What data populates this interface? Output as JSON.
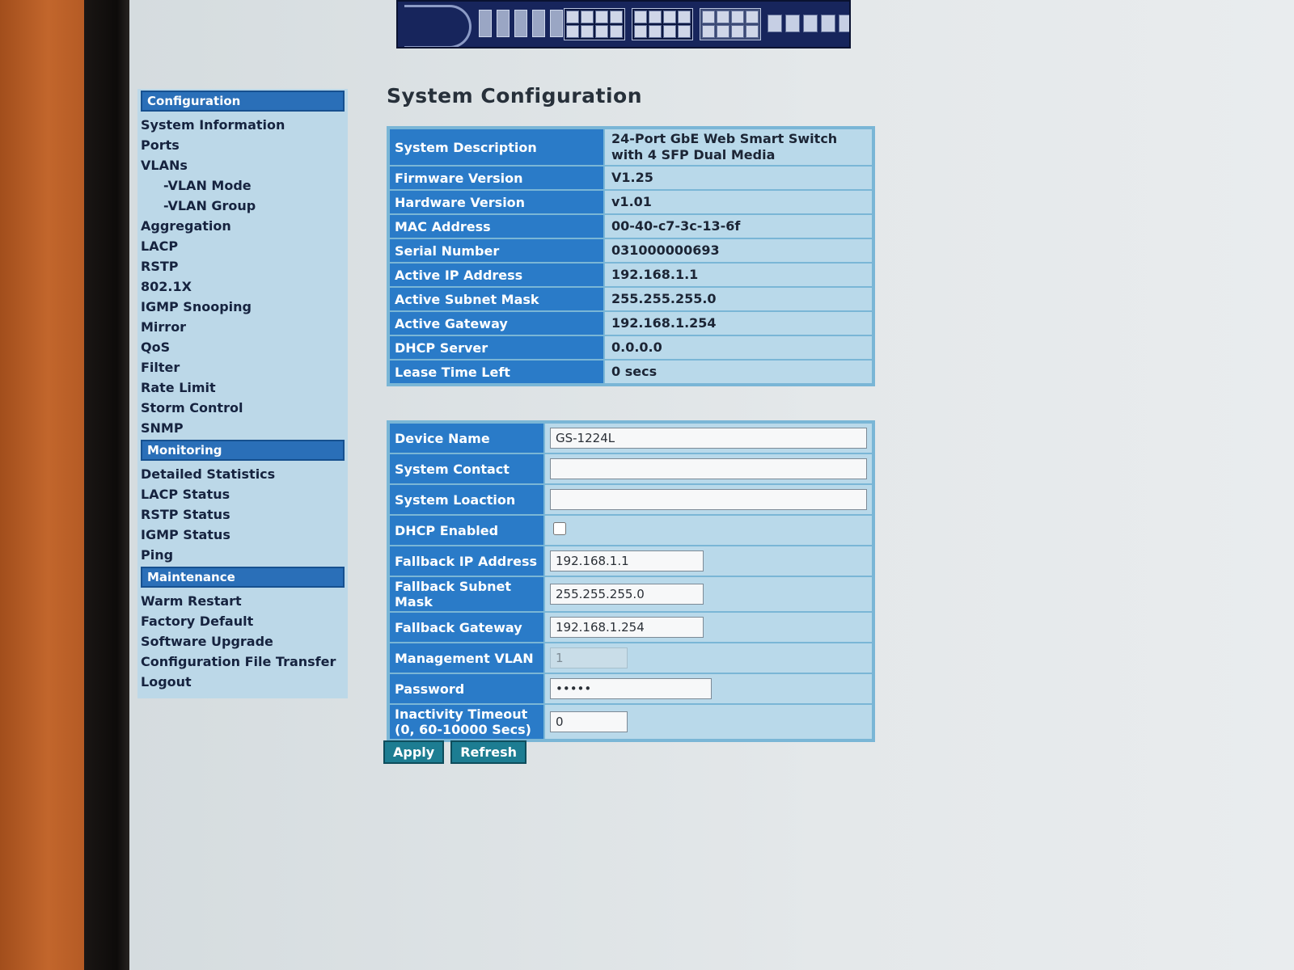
{
  "page": {
    "title": "System Configuration"
  },
  "nav": {
    "sections": [
      {
        "header": "Configuration",
        "items": [
          {
            "label": "System Information",
            "sub": false
          },
          {
            "label": "Ports",
            "sub": false
          },
          {
            "label": "VLANs",
            "sub": false
          },
          {
            "label": "-VLAN Mode",
            "sub": true
          },
          {
            "label": "-VLAN Group",
            "sub": true
          },
          {
            "label": "Aggregation",
            "sub": false
          },
          {
            "label": "LACP",
            "sub": false
          },
          {
            "label": "RSTP",
            "sub": false
          },
          {
            "label": "802.1X",
            "sub": false
          },
          {
            "label": "IGMP Snooping",
            "sub": false
          },
          {
            "label": "Mirror",
            "sub": false
          },
          {
            "label": "QoS",
            "sub": false
          },
          {
            "label": "Filter",
            "sub": false
          },
          {
            "label": "Rate Limit",
            "sub": false
          },
          {
            "label": "Storm Control",
            "sub": false
          },
          {
            "label": "SNMP",
            "sub": false
          }
        ]
      },
      {
        "header": "Monitoring",
        "items": [
          {
            "label": "Detailed Statistics",
            "sub": false
          },
          {
            "label": "LACP Status",
            "sub": false
          },
          {
            "label": "RSTP Status",
            "sub": false
          },
          {
            "label": "IGMP Status",
            "sub": false
          },
          {
            "label": "Ping",
            "sub": false
          }
        ]
      },
      {
        "header": "Maintenance",
        "items": [
          {
            "label": "Warm Restart",
            "sub": false
          },
          {
            "label": "Factory Default",
            "sub": false
          },
          {
            "label": "Software Upgrade",
            "sub": false
          },
          {
            "label": "Configuration File Transfer",
            "sub": false
          },
          {
            "label": "Logout",
            "sub": false
          }
        ]
      }
    ]
  },
  "info": [
    {
      "label": "System Description",
      "value": "24-Port GbE Web Smart Switch with 4 SFP Dual Media"
    },
    {
      "label": "Firmware Version",
      "value": "V1.25"
    },
    {
      "label": "Hardware Version",
      "value": "v1.01"
    },
    {
      "label": "MAC Address",
      "value": "00-40-c7-3c-13-6f"
    },
    {
      "label": "Serial Number",
      "value": "031000000693"
    },
    {
      "label": "Active IP Address",
      "value": "192.168.1.1"
    },
    {
      "label": "Active Subnet Mask",
      "value": "255.255.255.0"
    },
    {
      "label": "Active Gateway",
      "value": "192.168.1.254"
    },
    {
      "label": "DHCP Server",
      "value": "0.0.0.0"
    },
    {
      "label": "Lease Time Left",
      "value": "0 secs"
    }
  ],
  "form": {
    "device_name": {
      "label": "Device Name",
      "value": "GS-1224L"
    },
    "system_contact": {
      "label": "System Contact",
      "value": ""
    },
    "system_location": {
      "label": "System Loaction",
      "value": ""
    },
    "dhcp_enabled": {
      "label": "DHCP Enabled",
      "checked": false
    },
    "fallback_ip": {
      "label": "Fallback IP Address",
      "value": "192.168.1.1"
    },
    "fallback_mask": {
      "label": "Fallback Subnet Mask",
      "value": "255.255.255.0"
    },
    "fallback_gateway": {
      "label": "Fallback Gateway",
      "value": "192.168.1.254"
    },
    "management_vlan": {
      "label": "Management VLAN",
      "value": "1"
    },
    "password": {
      "label": "Password",
      "value": "admin"
    },
    "inactivity_timeout": {
      "label": "Inactivity Timeout (0, 60-10000 Secs)",
      "value": "0"
    }
  },
  "buttons": {
    "apply": "Apply",
    "refresh": "Refresh"
  },
  "colors": {
    "header_blue": "#2a7bc8",
    "cell_light_blue": "#b9d9ea",
    "button_teal": "#1d7d92",
    "banner_navy": "#17255c"
  }
}
